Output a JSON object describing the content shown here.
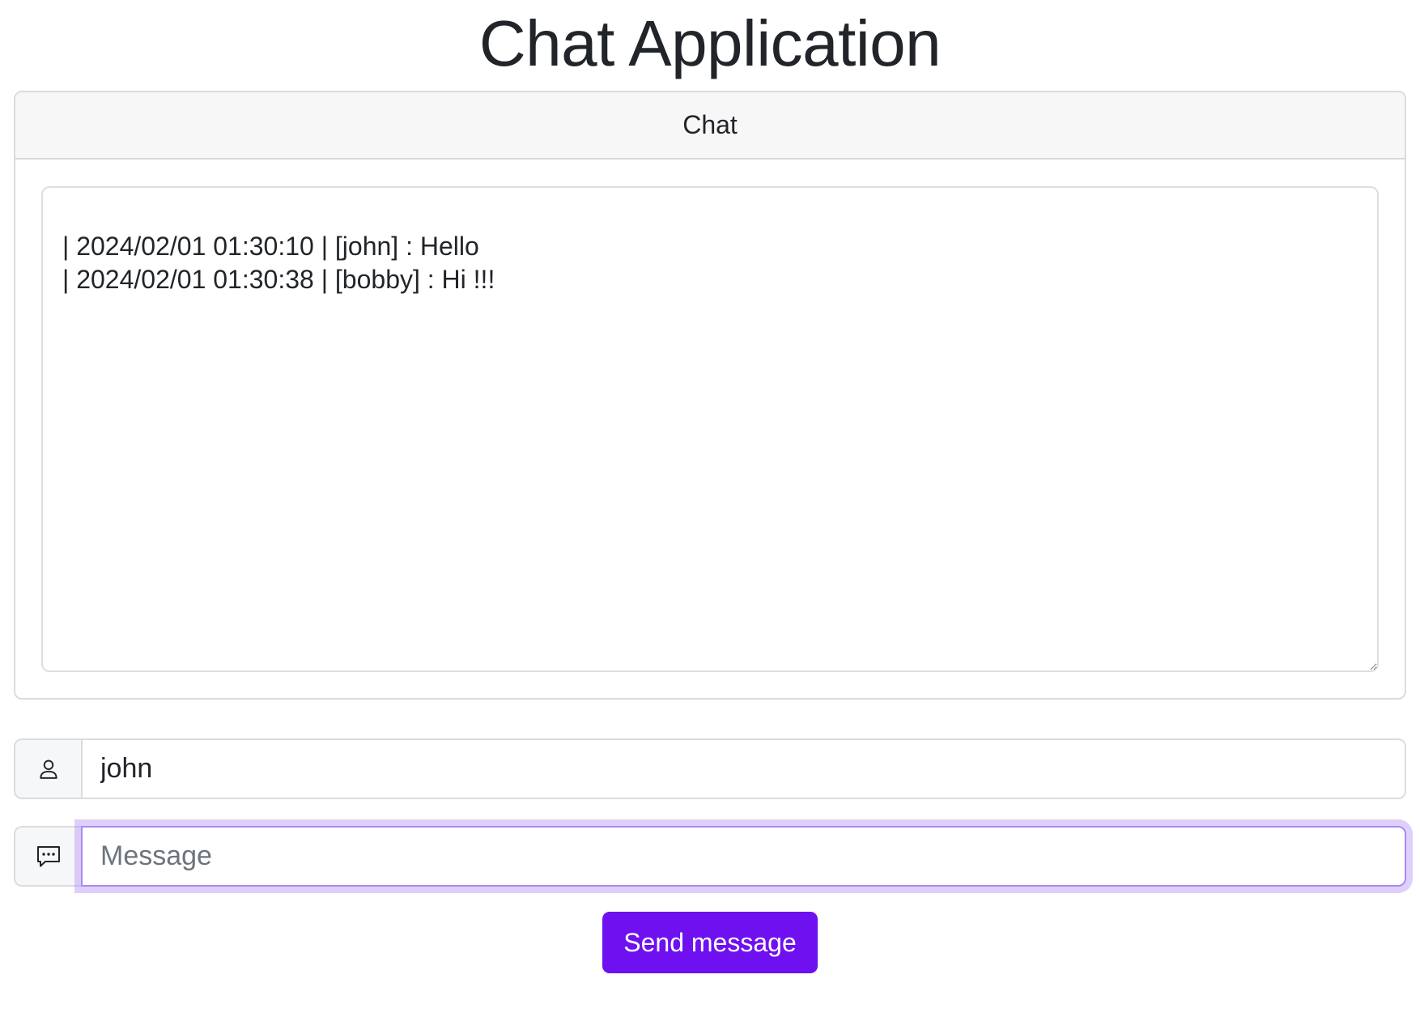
{
  "page": {
    "title": "Chat Application"
  },
  "chat": {
    "header": "Chat",
    "log": "| 2024/02/01 01:30:10 | [john] : Hello\n| 2024/02/01 01:30:38 | [bobby] : Hi !!!"
  },
  "form": {
    "username_icon": "person-icon",
    "username_value": "john",
    "message_icon": "chat-dots-icon",
    "message_value": "",
    "message_placeholder": "Message",
    "send_label": "Send message"
  },
  "colors": {
    "primary": "#6f10f0",
    "focus_ring": "#c9b2f8",
    "text": "#212529"
  }
}
